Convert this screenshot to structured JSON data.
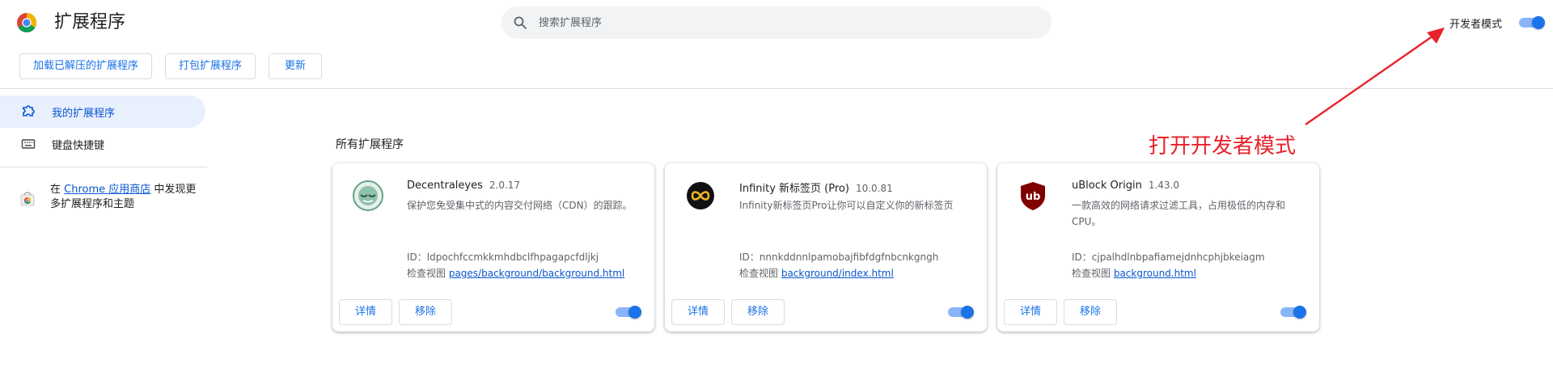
{
  "header": {
    "title": "扩展程序",
    "search_placeholder": "搜索扩展程序",
    "dev_mode_label": "开发者模式",
    "dev_mode_on": true
  },
  "toolbar": {
    "load_unpacked": "加载已解压的扩展程序",
    "pack_extension": "打包扩展程序",
    "update": "更新"
  },
  "sidebar": {
    "my_extensions": "我的扩展程序",
    "keyboard_shortcuts": "键盘快捷键",
    "store_prefix": "在 ",
    "store_link": "Chrome 应用商店",
    "store_suffix": " 中发现更多扩展程序和主题"
  },
  "section_title": "所有扩展程序",
  "extensions": [
    {
      "name": "Decentraleyes",
      "version": "2.0.17",
      "description": "保护您免受集中式的内容交付网络（CDN）的跟踪。",
      "id_label": "ID：",
      "id": "ldpochfccmkkmhdbclfhpagapcfdljkj",
      "inspect_label": "检查视图 ",
      "inspect_link": "pages/background/background.html",
      "details": "详情",
      "remove": "移除",
      "enabled": true,
      "icon": "decentraleyes-icon"
    },
    {
      "name": "Infinity 新标签页 (Pro)",
      "version": "10.0.81",
      "description": "Infinity新标签页Pro让你可以自定义你的新标签页",
      "id_label": "ID：",
      "id": "nnnkddnnlpamobajfibfdgfnbcnkgngh",
      "inspect_label": "检查视图 ",
      "inspect_link": "background/index.html",
      "details": "详情",
      "remove": "移除",
      "enabled": true,
      "icon": "infinity-icon"
    },
    {
      "name": "uBlock Origin",
      "version": "1.43.0",
      "description": "一款高效的网络请求过滤工具，占用极低的内存和CPU。",
      "id_label": "ID：",
      "id": "cjpalhdlnbpafiamejdnhcphjbkeiagm",
      "inspect_label": "检查视图 ",
      "inspect_link": "background.html",
      "details": "详情",
      "remove": "移除",
      "enabled": true,
      "icon": "ublock-icon"
    }
  ],
  "annotation": {
    "text": "打开开发者模式",
    "color": "#e8222b"
  },
  "colors": {
    "accent": "#1a73e8",
    "link": "#0b57d0",
    "active_bg": "#e8effd"
  }
}
